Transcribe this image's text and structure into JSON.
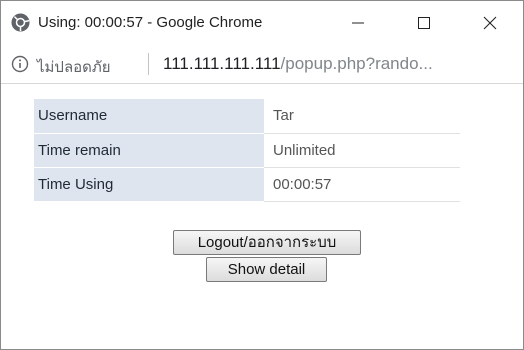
{
  "window": {
    "title": "Using: 00:00:57 - Google Chrome",
    "controls": {
      "minimize_icon": "minimize-icon",
      "maximize_icon": "maximize-icon",
      "close_icon": "close-icon"
    }
  },
  "addressbar": {
    "security_label": "ไม่ปลอดภัย",
    "url_host": "111.111.111.111",
    "url_path": "/popup.php?rando..."
  },
  "session": {
    "rows": [
      {
        "label": "Username",
        "value": "Tar"
      },
      {
        "label": "Time remain",
        "value": "Unlimited"
      },
      {
        "label": "Time Using",
        "value": "00:00:57"
      }
    ]
  },
  "actions": {
    "logout_label": "Logout/ออกจากระบบ",
    "detail_label": "Show detail"
  },
  "colors": {
    "label_bg": "#dfe5ef",
    "chrome_blue": "#1a73e8"
  }
}
